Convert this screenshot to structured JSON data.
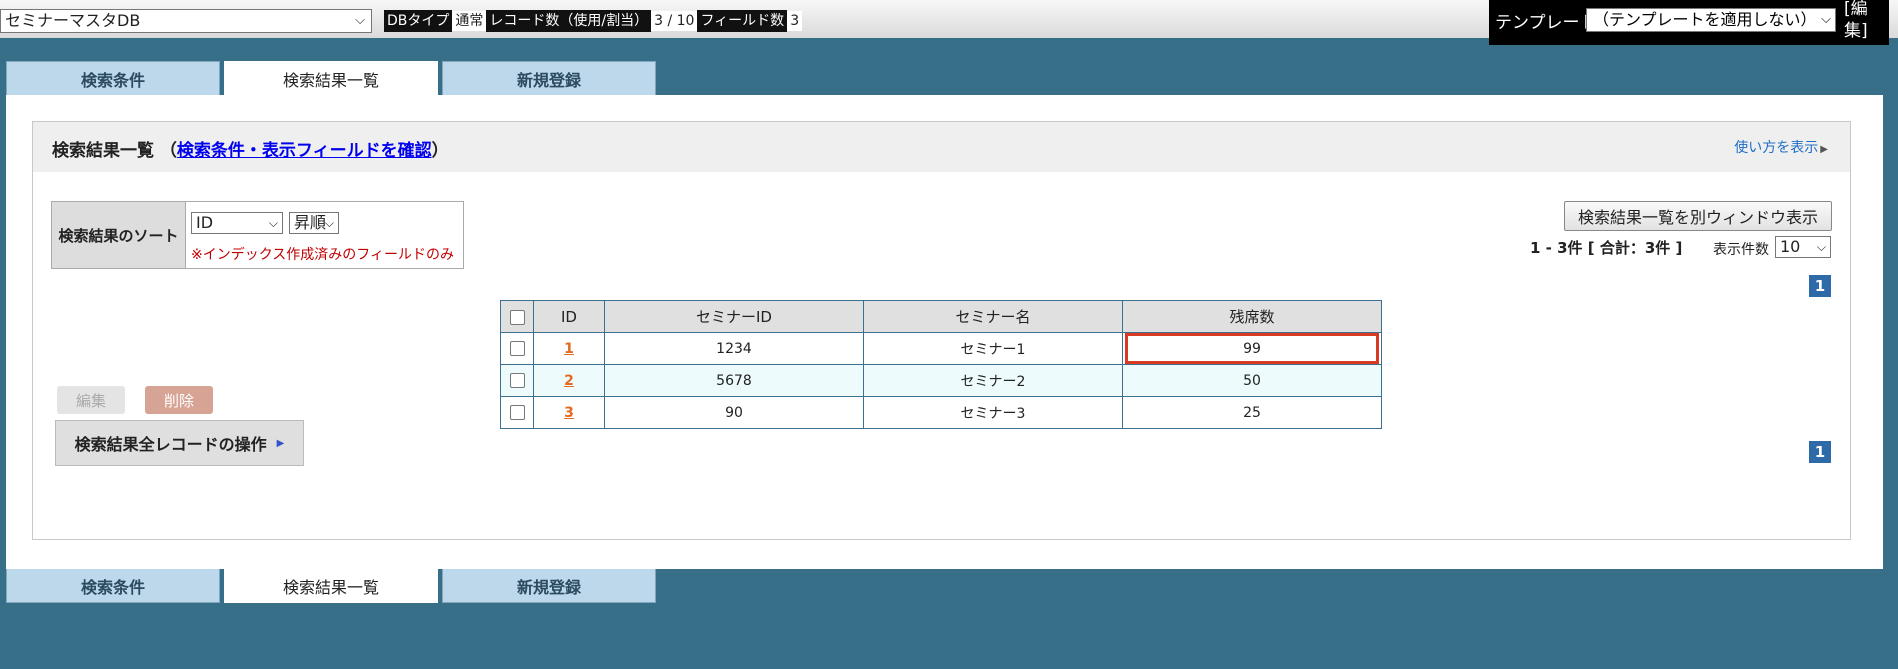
{
  "topbar": {
    "db_name": "セミナーマスタDB",
    "info": [
      {
        "label": "DBタイプ",
        "value": "通常"
      },
      {
        "label": "レコード数（使用/割当）",
        "value": "3 / 10"
      },
      {
        "label": "フィールド数",
        "value": "3"
      }
    ],
    "template_label": "テンプレート",
    "template_value": "（テンプレートを適用しない）",
    "template_edit": "[編集]"
  },
  "tabs": [
    {
      "label": "検索条件",
      "active": false
    },
    {
      "label": "検索結果一覧",
      "active": true
    },
    {
      "label": "新規登録",
      "active": false
    }
  ],
  "panel": {
    "title": "検索結果一覧",
    "title_open": "（",
    "title_link": "検索条件・表示フィールドを確認",
    "title_close": "）",
    "howto": "使い方を表示"
  },
  "sort": {
    "label": "検索結果のソート",
    "field": "ID",
    "order": "昇順",
    "note": "※インデックス作成済みのフィールドのみ"
  },
  "controls": {
    "new_window_button": "検索結果一覧を別ウィンドウ表示",
    "count_text": "1 - 3件 [ 合計：3件 ]",
    "per_page_label": "表示件数",
    "per_page_value": "10",
    "page_number": "1"
  },
  "table": {
    "columns": [
      "ID",
      "セミナーID",
      "セミナー名",
      "残席数"
    ],
    "rows": [
      {
        "id": "1",
        "seminar_id": "1234",
        "seminar_name": "セミナー1",
        "seats": "99"
      },
      {
        "id": "2",
        "seminar_id": "5678",
        "seminar_name": "セミナー2",
        "seats": "50"
      },
      {
        "id": "3",
        "seminar_id": "90",
        "seminar_name": "セミナー3",
        "seats": "25"
      }
    ]
  },
  "actions": {
    "edit": "編集",
    "delete": "削除",
    "all_records": "検索結果全レコードの操作"
  },
  "colors": {
    "background": "#366f87",
    "tab_inactive": "#bcd8ea",
    "pager_badge": "#2e6aa8",
    "highlight_border": "#d83a22",
    "link_orange": "#e46a1f"
  }
}
